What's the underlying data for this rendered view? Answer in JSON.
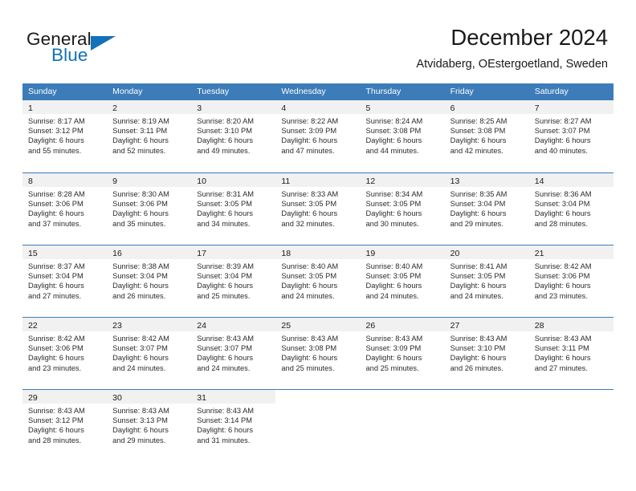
{
  "brand": {
    "word_one": "General",
    "word_two": "Blue",
    "accent_color": "#1271b8",
    "triangle_icon": "triangle-icon"
  },
  "header": {
    "title": "December 2024",
    "subtitle": "Atvidaberg, OEstergoetland, Sweden"
  },
  "calendar": {
    "header_bg": "#3c7cb8",
    "day_band_bg": "#f1f1f1",
    "weekday_headers": [
      "Sunday",
      "Monday",
      "Tuesday",
      "Wednesday",
      "Thursday",
      "Friday",
      "Saturday"
    ],
    "weeks": [
      [
        {
          "day": "1",
          "sunrise": "Sunrise: 8:17 AM",
          "sunset": "Sunset: 3:12 PM",
          "daylight_line1": "Daylight: 6 hours",
          "daylight_line2": "and 55 minutes."
        },
        {
          "day": "2",
          "sunrise": "Sunrise: 8:19 AM",
          "sunset": "Sunset: 3:11 PM",
          "daylight_line1": "Daylight: 6 hours",
          "daylight_line2": "and 52 minutes."
        },
        {
          "day": "3",
          "sunrise": "Sunrise: 8:20 AM",
          "sunset": "Sunset: 3:10 PM",
          "daylight_line1": "Daylight: 6 hours",
          "daylight_line2": "and 49 minutes."
        },
        {
          "day": "4",
          "sunrise": "Sunrise: 8:22 AM",
          "sunset": "Sunset: 3:09 PM",
          "daylight_line1": "Daylight: 6 hours",
          "daylight_line2": "and 47 minutes."
        },
        {
          "day": "5",
          "sunrise": "Sunrise: 8:24 AM",
          "sunset": "Sunset: 3:08 PM",
          "daylight_line1": "Daylight: 6 hours",
          "daylight_line2": "and 44 minutes."
        },
        {
          "day": "6",
          "sunrise": "Sunrise: 8:25 AM",
          "sunset": "Sunset: 3:08 PM",
          "daylight_line1": "Daylight: 6 hours",
          "daylight_line2": "and 42 minutes."
        },
        {
          "day": "7",
          "sunrise": "Sunrise: 8:27 AM",
          "sunset": "Sunset: 3:07 PM",
          "daylight_line1": "Daylight: 6 hours",
          "daylight_line2": "and 40 minutes."
        }
      ],
      [
        {
          "day": "8",
          "sunrise": "Sunrise: 8:28 AM",
          "sunset": "Sunset: 3:06 PM",
          "daylight_line1": "Daylight: 6 hours",
          "daylight_line2": "and 37 minutes."
        },
        {
          "day": "9",
          "sunrise": "Sunrise: 8:30 AM",
          "sunset": "Sunset: 3:06 PM",
          "daylight_line1": "Daylight: 6 hours",
          "daylight_line2": "and 35 minutes."
        },
        {
          "day": "10",
          "sunrise": "Sunrise: 8:31 AM",
          "sunset": "Sunset: 3:05 PM",
          "daylight_line1": "Daylight: 6 hours",
          "daylight_line2": "and 34 minutes."
        },
        {
          "day": "11",
          "sunrise": "Sunrise: 8:33 AM",
          "sunset": "Sunset: 3:05 PM",
          "daylight_line1": "Daylight: 6 hours",
          "daylight_line2": "and 32 minutes."
        },
        {
          "day": "12",
          "sunrise": "Sunrise: 8:34 AM",
          "sunset": "Sunset: 3:05 PM",
          "daylight_line1": "Daylight: 6 hours",
          "daylight_line2": "and 30 minutes."
        },
        {
          "day": "13",
          "sunrise": "Sunrise: 8:35 AM",
          "sunset": "Sunset: 3:04 PM",
          "daylight_line1": "Daylight: 6 hours",
          "daylight_line2": "and 29 minutes."
        },
        {
          "day": "14",
          "sunrise": "Sunrise: 8:36 AM",
          "sunset": "Sunset: 3:04 PM",
          "daylight_line1": "Daylight: 6 hours",
          "daylight_line2": "and 28 minutes."
        }
      ],
      [
        {
          "day": "15",
          "sunrise": "Sunrise: 8:37 AM",
          "sunset": "Sunset: 3:04 PM",
          "daylight_line1": "Daylight: 6 hours",
          "daylight_line2": "and 27 minutes."
        },
        {
          "day": "16",
          "sunrise": "Sunrise: 8:38 AM",
          "sunset": "Sunset: 3:04 PM",
          "daylight_line1": "Daylight: 6 hours",
          "daylight_line2": "and 26 minutes."
        },
        {
          "day": "17",
          "sunrise": "Sunrise: 8:39 AM",
          "sunset": "Sunset: 3:04 PM",
          "daylight_line1": "Daylight: 6 hours",
          "daylight_line2": "and 25 minutes."
        },
        {
          "day": "18",
          "sunrise": "Sunrise: 8:40 AM",
          "sunset": "Sunset: 3:05 PM",
          "daylight_line1": "Daylight: 6 hours",
          "daylight_line2": "and 24 minutes."
        },
        {
          "day": "19",
          "sunrise": "Sunrise: 8:40 AM",
          "sunset": "Sunset: 3:05 PM",
          "daylight_line1": "Daylight: 6 hours",
          "daylight_line2": "and 24 minutes."
        },
        {
          "day": "20",
          "sunrise": "Sunrise: 8:41 AM",
          "sunset": "Sunset: 3:05 PM",
          "daylight_line1": "Daylight: 6 hours",
          "daylight_line2": "and 24 minutes."
        },
        {
          "day": "21",
          "sunrise": "Sunrise: 8:42 AM",
          "sunset": "Sunset: 3:06 PM",
          "daylight_line1": "Daylight: 6 hours",
          "daylight_line2": "and 23 minutes."
        }
      ],
      [
        {
          "day": "22",
          "sunrise": "Sunrise: 8:42 AM",
          "sunset": "Sunset: 3:06 PM",
          "daylight_line1": "Daylight: 6 hours",
          "daylight_line2": "and 23 minutes."
        },
        {
          "day": "23",
          "sunrise": "Sunrise: 8:42 AM",
          "sunset": "Sunset: 3:07 PM",
          "daylight_line1": "Daylight: 6 hours",
          "daylight_line2": "and 24 minutes."
        },
        {
          "day": "24",
          "sunrise": "Sunrise: 8:43 AM",
          "sunset": "Sunset: 3:07 PM",
          "daylight_line1": "Daylight: 6 hours",
          "daylight_line2": "and 24 minutes."
        },
        {
          "day": "25",
          "sunrise": "Sunrise: 8:43 AM",
          "sunset": "Sunset: 3:08 PM",
          "daylight_line1": "Daylight: 6 hours",
          "daylight_line2": "and 25 minutes."
        },
        {
          "day": "26",
          "sunrise": "Sunrise: 8:43 AM",
          "sunset": "Sunset: 3:09 PM",
          "daylight_line1": "Daylight: 6 hours",
          "daylight_line2": "and 25 minutes."
        },
        {
          "day": "27",
          "sunrise": "Sunrise: 8:43 AM",
          "sunset": "Sunset: 3:10 PM",
          "daylight_line1": "Daylight: 6 hours",
          "daylight_line2": "and 26 minutes."
        },
        {
          "day": "28",
          "sunrise": "Sunrise: 8:43 AM",
          "sunset": "Sunset: 3:11 PM",
          "daylight_line1": "Daylight: 6 hours",
          "daylight_line2": "and 27 minutes."
        }
      ],
      [
        {
          "day": "29",
          "sunrise": "Sunrise: 8:43 AM",
          "sunset": "Sunset: 3:12 PM",
          "daylight_line1": "Daylight: 6 hours",
          "daylight_line2": "and 28 minutes."
        },
        {
          "day": "30",
          "sunrise": "Sunrise: 8:43 AM",
          "sunset": "Sunset: 3:13 PM",
          "daylight_line1": "Daylight: 6 hours",
          "daylight_line2": "and 29 minutes."
        },
        {
          "day": "31",
          "sunrise": "Sunrise: 8:43 AM",
          "sunset": "Sunset: 3:14 PM",
          "daylight_line1": "Daylight: 6 hours",
          "daylight_line2": "and 31 minutes."
        },
        null,
        null,
        null,
        null
      ]
    ]
  }
}
